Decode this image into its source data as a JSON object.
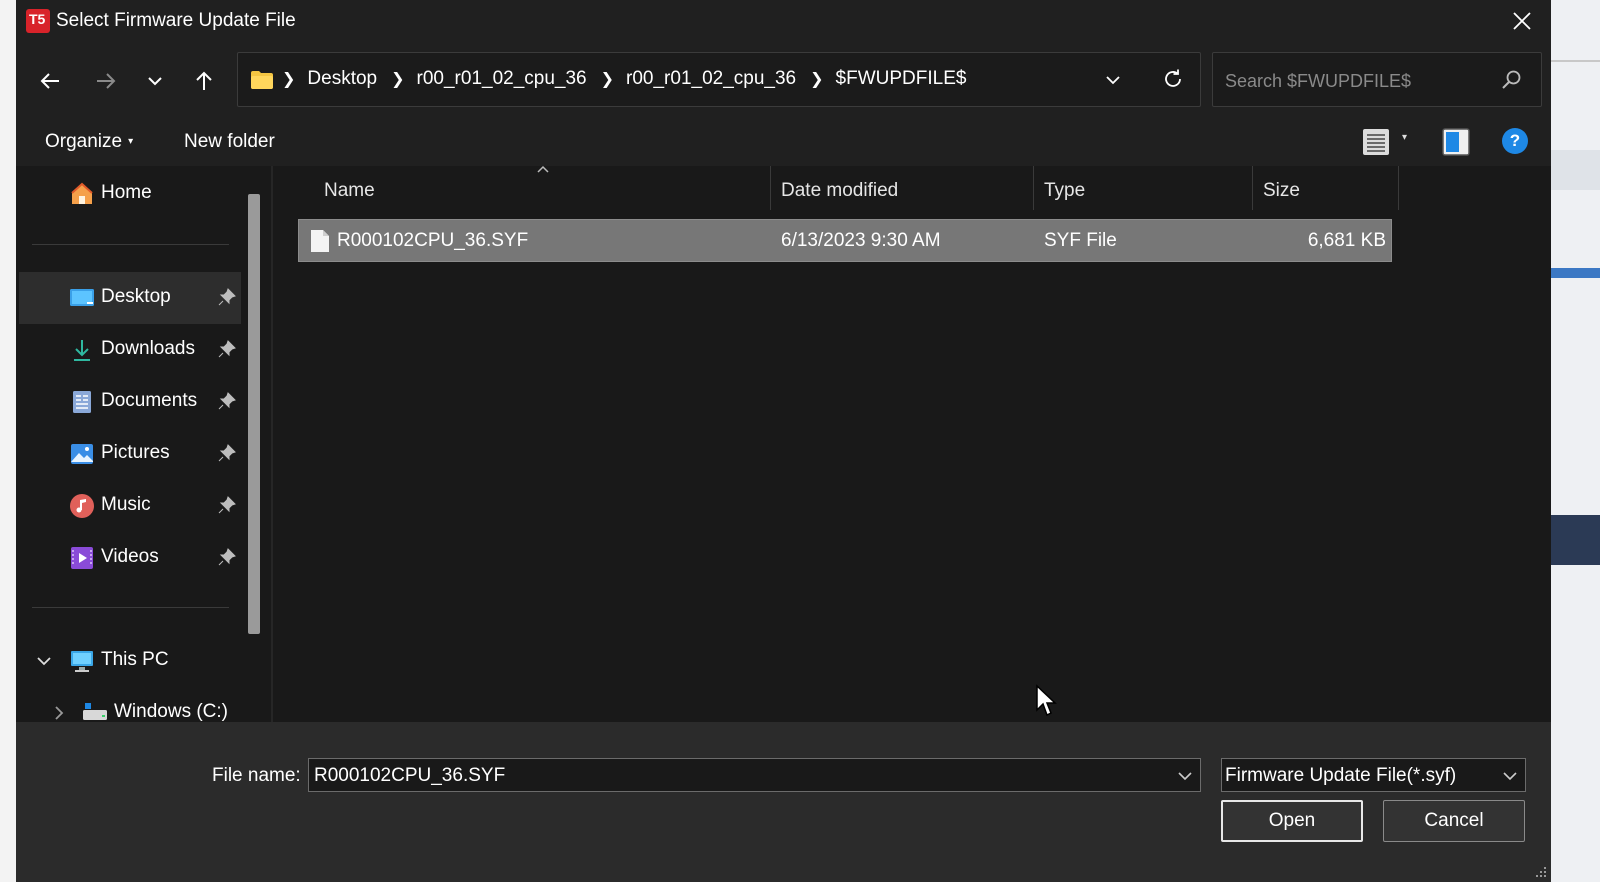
{
  "window": {
    "title": "Select Firmware Update File",
    "app_icon_text": "T5"
  },
  "navigation": {
    "breadcrumbs": [
      "Desktop",
      "r00_r01_02_cpu_36",
      "r00_r01_02_cpu_36",
      "$FWUPDFILE$"
    ],
    "search_placeholder": "Search $FWUPDFILE$"
  },
  "toolbar": {
    "organize_label": "Organize",
    "new_folder_label": "New folder"
  },
  "sidebar": {
    "home": "Home",
    "pinned": [
      {
        "label": "Desktop",
        "icon": "desktop-icon"
      },
      {
        "label": "Downloads",
        "icon": "downloads-icon"
      },
      {
        "label": "Documents",
        "icon": "documents-icon"
      },
      {
        "label": "Pictures",
        "icon": "pictures-icon"
      },
      {
        "label": "Music",
        "icon": "music-icon"
      },
      {
        "label": "Videos",
        "icon": "videos-icon"
      }
    ],
    "this_pc": "This PC",
    "drive": "Windows (C:)"
  },
  "file_list": {
    "columns": [
      "Name",
      "Date modified",
      "Type",
      "Size"
    ],
    "rows": [
      {
        "name": "R000102CPU_36.SYF",
        "date_modified": "6/13/2023 9:30 AM",
        "type": "SYF File",
        "size": "6,681 KB"
      }
    ]
  },
  "footer": {
    "file_name_label": "File name:",
    "file_name_value": "R000102CPU_36.SYF",
    "file_type_filter": "Firmware Update File(*.syf)",
    "open_label": "Open",
    "cancel_label": "Cancel"
  },
  "colors": {
    "accent_blue": "#1e88e5",
    "folder_yellow": "#f4c542",
    "app_icon_red": "#d8232a",
    "selection_gray": "#777777"
  }
}
